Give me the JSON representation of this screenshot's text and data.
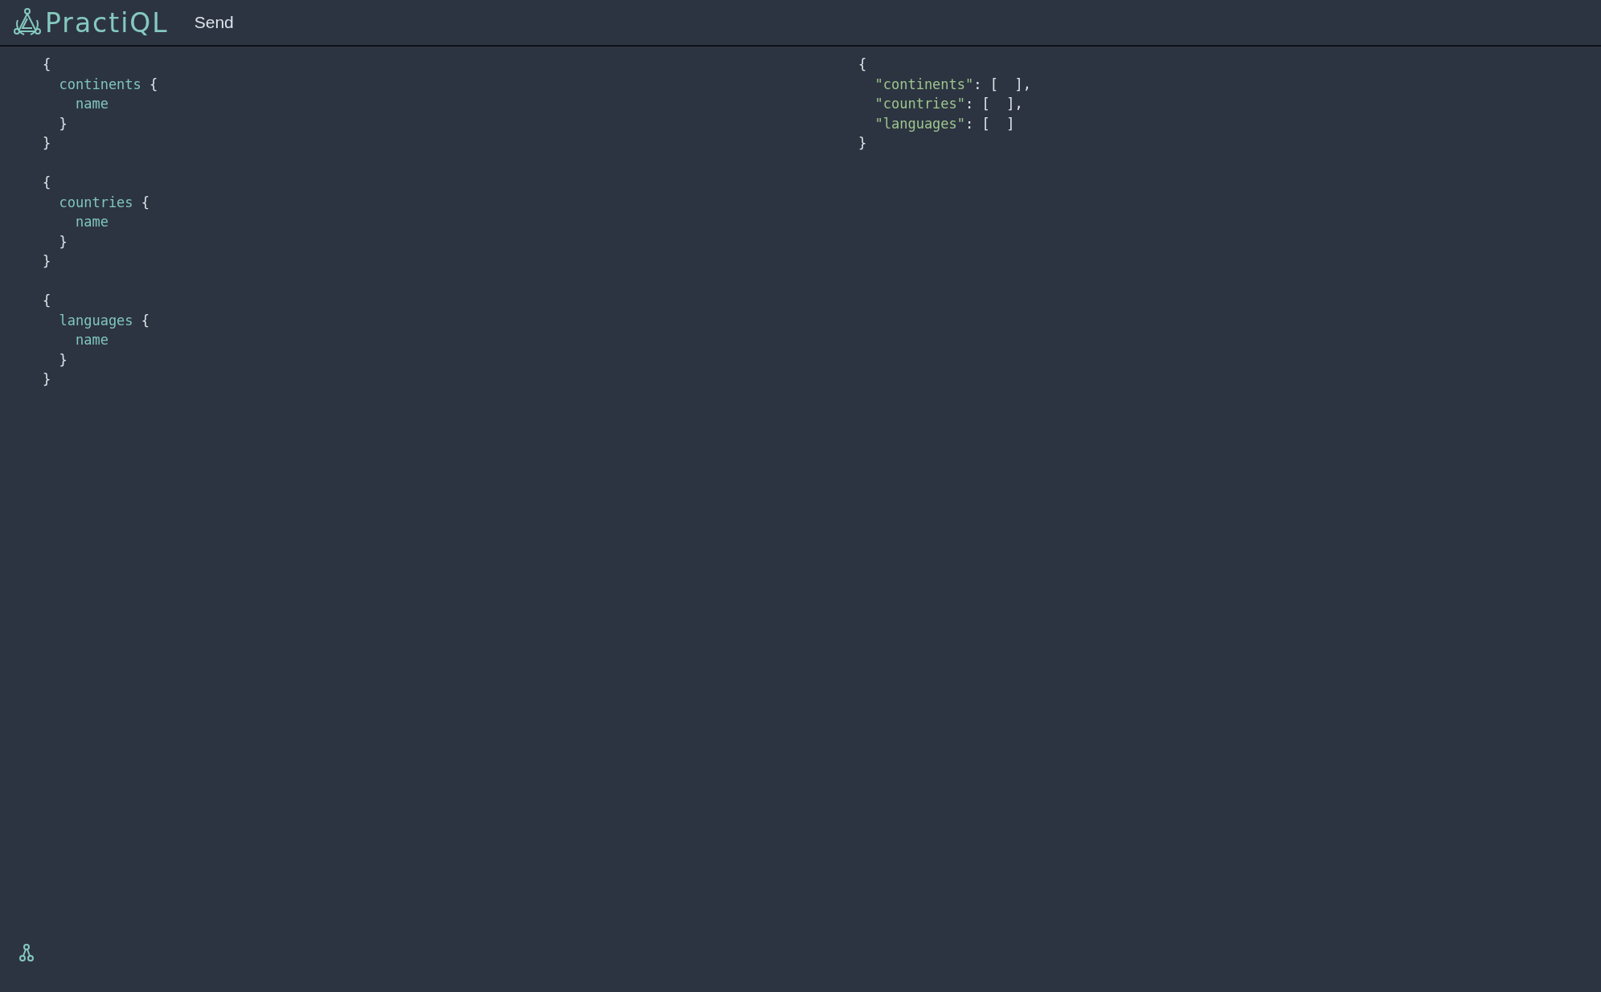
{
  "header": {
    "logo_text": "PractiQL",
    "send_button": "Send"
  },
  "query": {
    "blocks": [
      {
        "lines": [
          [
            {
              "text": "{",
              "kind": "punct"
            }
          ],
          [
            {
              "text": "  continents",
              "kind": "field"
            },
            {
              "text": " {",
              "kind": "punct"
            }
          ],
          [
            {
              "text": "    name",
              "kind": "field"
            }
          ],
          [
            {
              "text": "  }",
              "kind": "punct"
            }
          ],
          [
            {
              "text": "}",
              "kind": "punct"
            }
          ]
        ]
      },
      {
        "lines": [
          [
            {
              "text": "{",
              "kind": "punct"
            }
          ],
          [
            {
              "text": "  countries",
              "kind": "field"
            },
            {
              "text": " {",
              "kind": "punct"
            }
          ],
          [
            {
              "text": "    name",
              "kind": "field"
            }
          ],
          [
            {
              "text": "  }",
              "kind": "punct"
            }
          ],
          [
            {
              "text": "}",
              "kind": "punct"
            }
          ]
        ]
      },
      {
        "lines": [
          [
            {
              "text": "{",
              "kind": "punct"
            }
          ],
          [
            {
              "text": "  languages",
              "kind": "field"
            },
            {
              "text": " {",
              "kind": "punct"
            }
          ],
          [
            {
              "text": "    name",
              "kind": "field"
            }
          ],
          [
            {
              "text": "  }",
              "kind": "punct"
            }
          ],
          [
            {
              "text": "}",
              "kind": "punct"
            }
          ]
        ]
      }
    ]
  },
  "result": {
    "lines": [
      [
        {
          "text": "{",
          "kind": "punct"
        }
      ],
      [
        {
          "text": "  \"continents\"",
          "kind": "key"
        },
        {
          "text": ": [  ],",
          "kind": "punct"
        }
      ],
      [
        {
          "text": "  \"countries\"",
          "kind": "key"
        },
        {
          "text": ": [  ],",
          "kind": "punct"
        }
      ],
      [
        {
          "text": "  \"languages\"",
          "kind": "key"
        },
        {
          "text": ": [  ]",
          "kind": "punct"
        }
      ],
      [
        {
          "text": "}",
          "kind": "punct"
        }
      ]
    ]
  }
}
